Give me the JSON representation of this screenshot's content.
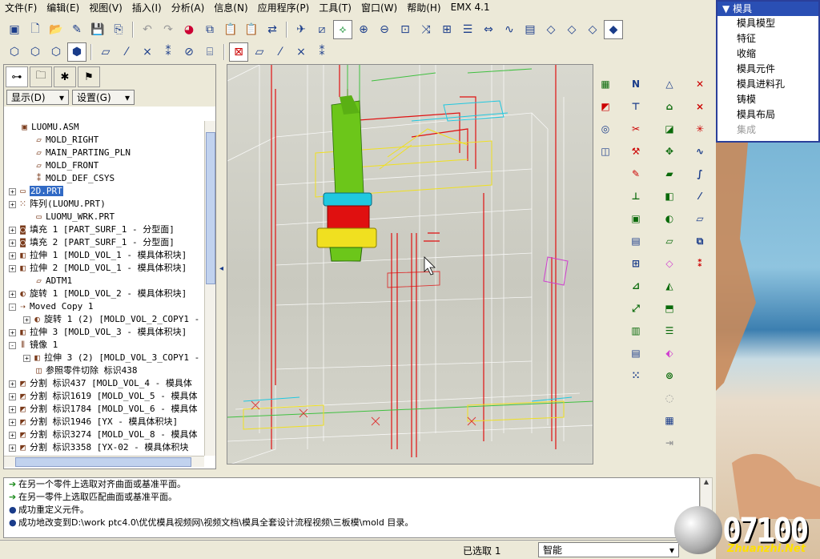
{
  "menu": [
    "文件(F)",
    "编辑(E)",
    "视图(V)",
    "插入(I)",
    "分析(A)",
    "信息(N)",
    "应用程序(P)",
    "工具(T)",
    "窗口(W)",
    "帮助(H)",
    "EMX 4.1"
  ],
  "left_panel": {
    "display_label": "显示(D)",
    "settings_label": "设置(G)"
  },
  "tree": [
    {
      "indent": 0,
      "exp": "",
      "icon": "asm-icon",
      "label": "LUOMU.ASM"
    },
    {
      "indent": 1,
      "exp": "",
      "icon": "datum-plane-icon",
      "label": "MOLD_RIGHT"
    },
    {
      "indent": 1,
      "exp": "",
      "icon": "datum-plane-icon",
      "label": "MAIN_PARTING_PLN"
    },
    {
      "indent": 1,
      "exp": "",
      "icon": "datum-plane-icon",
      "label": "MOLD_FRONT"
    },
    {
      "indent": 1,
      "exp": "",
      "icon": "csys-icon",
      "label": "MOLD_DEF_CSYS"
    },
    {
      "indent": 0,
      "exp": "+",
      "icon": "part-icon",
      "label": "2D.PRT",
      "selected": true
    },
    {
      "indent": 0,
      "exp": "+",
      "icon": "pattern-icon",
      "label": "阵列(LUOMU.PRT)"
    },
    {
      "indent": 1,
      "exp": "",
      "icon": "part-icon",
      "label": "LUOMU_WRK.PRT"
    },
    {
      "indent": 0,
      "exp": "+",
      "icon": "fill-icon",
      "label": "填充 1 [PART_SURF_1 - 分型面]"
    },
    {
      "indent": 0,
      "exp": "+",
      "icon": "fill-icon",
      "label": "填充 2 [PART_SURF_1 - 分型面]"
    },
    {
      "indent": 0,
      "exp": "+",
      "icon": "extrude-icon",
      "label": "拉伸 1 [MOLD_VOL_1 - 模具体积块]"
    },
    {
      "indent": 0,
      "exp": "+",
      "icon": "extrude-icon",
      "label": "拉伸 2 [MOLD_VOL_1 - 模具体积块]"
    },
    {
      "indent": 1,
      "exp": "",
      "icon": "datum-plane-icon",
      "label": "ADTM1"
    },
    {
      "indent": 0,
      "exp": "+",
      "icon": "revolve-icon",
      "label": "旋转 1 [MOLD_VOL_2 - 模具体积块]"
    },
    {
      "indent": 0,
      "exp": "-",
      "icon": "copy-icon",
      "label": "Moved Copy 1"
    },
    {
      "indent": 1,
      "exp": "+",
      "icon": "revolve-icon",
      "label": "旋转 1 (2) [MOLD_VOL_2_COPY1 -"
    },
    {
      "indent": 0,
      "exp": "+",
      "icon": "extrude-icon",
      "label": "拉伸 3 [MOLD_VOL_3 - 模具体积块]"
    },
    {
      "indent": 0,
      "exp": "-",
      "icon": "mirror-icon",
      "label": "镜像 1"
    },
    {
      "indent": 1,
      "exp": "+",
      "icon": "extrude-icon",
      "label": "拉伸 3 (2) [MOLD_VOL_3_COPY1 -"
    },
    {
      "indent": 1,
      "exp": "",
      "icon": "cut-icon",
      "label": "参照零件切除 标识438"
    },
    {
      "indent": 0,
      "exp": "+",
      "icon": "split-icon",
      "label": "分割 标识437 [MOLD_VOL_4 - 模具体"
    },
    {
      "indent": 0,
      "exp": "+",
      "icon": "split-icon",
      "label": "分割 标识1619 [MOLD_VOL_5 - 模具体"
    },
    {
      "indent": 0,
      "exp": "+",
      "icon": "split-icon",
      "label": "分割 标识1784 [MOLD_VOL_6 - 模具体"
    },
    {
      "indent": 0,
      "exp": "+",
      "icon": "split-icon",
      "label": "分割 标识1946 [YX - 模具体积块]"
    },
    {
      "indent": 0,
      "exp": "+",
      "icon": "split-icon",
      "label": "分割 标识3274 [MOLD_VOL_8 - 模具体"
    },
    {
      "indent": 0,
      "exp": "+",
      "icon": "split-icon",
      "label": "分割 标识3358 [YX-02 - 模具体积块"
    }
  ],
  "messages": [
    {
      "type": "arrow",
      "text": "在另一个零件上选取对齐曲面或基准平面。"
    },
    {
      "type": "arrow",
      "text": "在另一零件上选取匹配曲面或基准平面。"
    },
    {
      "type": "dot",
      "text": "成功重定义元件。"
    },
    {
      "type": "dot",
      "text": "成功地改变到D:\\work ptc4.0\\优优模具视频网\\视频文档\\模具全套设计流程视频\\三板模\\mold 目录。"
    }
  ],
  "status": {
    "selected_label": "已选取 1",
    "filter_value": "智能"
  },
  "mold_menu": {
    "header": "模具",
    "items": [
      "模具模型",
      "特征",
      "收缩",
      "模具元件",
      "模具进料孔",
      "铸模",
      "模具布局",
      "集成"
    ]
  },
  "watermark": {
    "number": "07100",
    "site": "Zhuanzhi.Net"
  },
  "colors": {
    "accent": "#2a4fb4",
    "select": "#316ac5",
    "green": "#6cc61a",
    "red": "#e01010",
    "yellow": "#f0e020",
    "cyan": "#20c8e0"
  }
}
